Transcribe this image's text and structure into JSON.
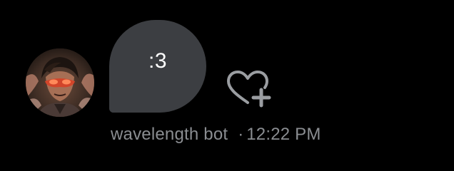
{
  "message": {
    "text": ":3",
    "sender": "wavelength bot",
    "separator": "·",
    "time": "12:22 PM",
    "avatar_icon": "avatar-portrait",
    "react_icon": "heart-plus-icon"
  },
  "colors": {
    "background": "#000000",
    "bubble": "#3c3e42",
    "bubble_text": "#ffffff",
    "meta_text": "#8a8d91",
    "react_icon": "#9a9da1"
  }
}
